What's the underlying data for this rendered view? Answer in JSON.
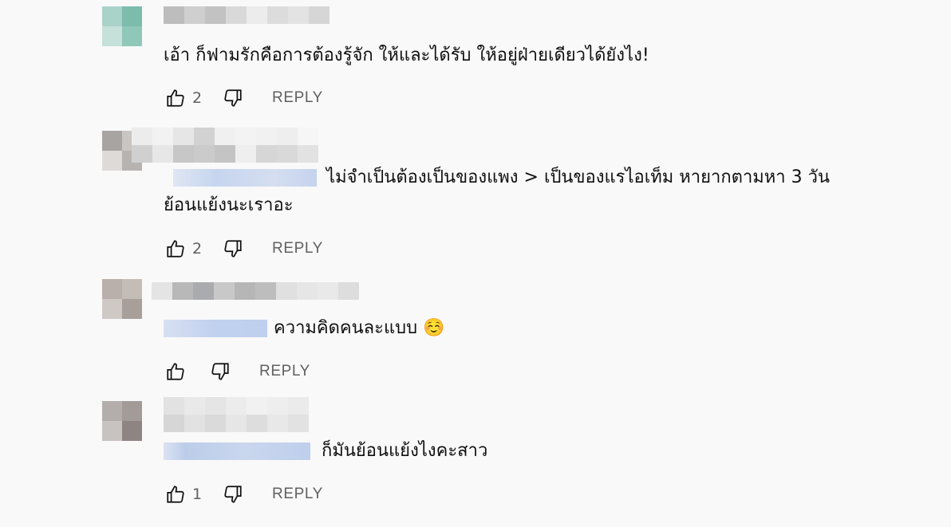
{
  "comments": [
    {
      "text": "เอ้า ก็ฟามรักคือการต้องรู้จัก ให้และได้รับ  ให้อยู่ฝ่ายเดียวได้ยังไง!",
      "likes": "2",
      "reply_label": "REPLY",
      "avatar_colors": [
        "#a9d2c9",
        "#7cbcad",
        "#c6e0da",
        "#8fc7b9"
      ]
    },
    {
      "text_line1": "ไม่จำเป็นต้องเป็นของแพง > เป็นของแรไอเท็ม หายากตามหา 3 วัน",
      "text_line2": "ย้อนแย้งนะเราอะ",
      "likes": "2",
      "reply_label": "REPLY",
      "avatar_colors": [
        "#a8a4a2",
        "#c9c5c3",
        "#dedad8",
        "#b7b3b1"
      ]
    },
    {
      "text": "ความคิดคนละแบบ ☺️",
      "likes": "",
      "reply_label": "REPLY",
      "avatar_colors": [
        "#b9b0ab",
        "#c4bcb7",
        "#cfc9c6",
        "#a89f9b"
      ]
    },
    {
      "text": "ก็มันย้อนแย้งไงคะสาว",
      "likes": "1",
      "reply_label": "REPLY",
      "avatar_colors": [
        "#b3aeac",
        "#a39b98",
        "#c7c3c1",
        "#8e8582"
      ]
    }
  ]
}
